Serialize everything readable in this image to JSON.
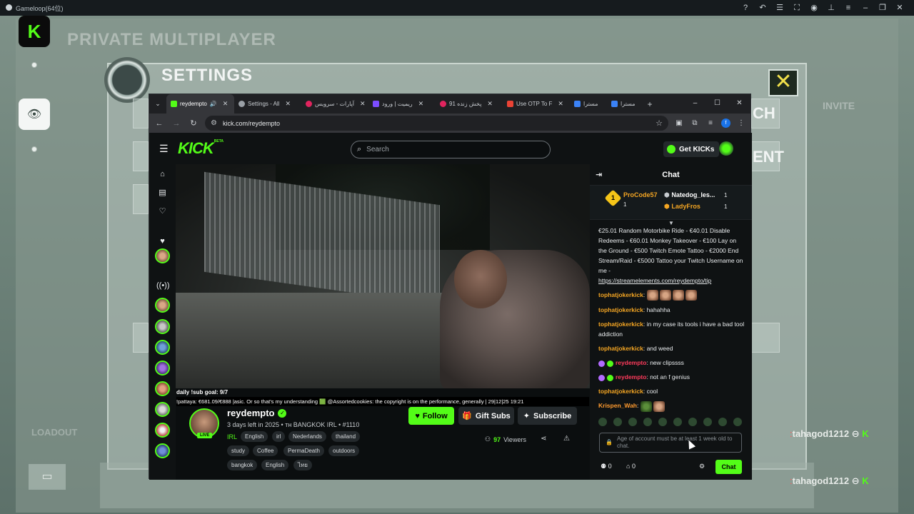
{
  "emulator": {
    "title": "Gameloop(64位)"
  },
  "game": {
    "title_private": "PRIVATE MULTIPLAYER",
    "settings_title": "SETTINGS",
    "right_label_1": "CH",
    "right_label_2": "ENT",
    "invite_label": "INVITE",
    "loadout_label": "LOADOUT",
    "chat_user_1": "tahagod1212",
    "chat_user_2": "tahagod1212",
    "close_glyph": "✕"
  },
  "browser": {
    "tabs": [
      {
        "label": "reydempto",
        "color": "#53fc18",
        "active": true
      },
      {
        "label": "Settings - All",
        "color": "#9aa0a6",
        "active": false
      },
      {
        "label": "آپارات - سرویس",
        "color": "#e0245e",
        "active": false
      },
      {
        "label": "ریمیت | ورود",
        "color": "#7c4dff",
        "active": false
      },
      {
        "label": "پخش زنده 91",
        "color": "#e0245e",
        "active": false
      },
      {
        "label": "Use OTP To F",
        "color": "#ea4335",
        "active": false
      },
      {
        "label": "مسترا",
        "color": "#3b82f6",
        "active": false
      },
      {
        "label": "مسترا",
        "color": "#3b82f6",
        "active": false
      }
    ],
    "url": "kick.com/reydempto",
    "profile_letter": "f"
  },
  "kick": {
    "logo": "KICK",
    "logo_beta": "BETA",
    "search_placeholder": "Search",
    "get_kicks": "Get KICKs",
    "sub_goal": "daily !sub goal: 9/7",
    "ticker": "!pattaya: €681.09/€888  |asic. Or so that's my understanding   🟩 @Assortedcookies:   the copyright is on the performance, generally | 29|12|25 19:21",
    "channel": {
      "name": "reydempto",
      "live": "LIVE",
      "title": "3 days left in 2025 • тн BANGKOK IRL • #1110",
      "category": "IRL",
      "tags": [
        "English",
        "irl",
        "Nederlands",
        "thailand",
        "study",
        "Coffee",
        "PermaDeath",
        "outdoors",
        "bangkok",
        "English",
        "ไทย"
      ],
      "viewers_count": "97",
      "viewers_label": "Viewers"
    },
    "buttons": {
      "follow": "Follow",
      "gift_subs": "Gift Subs",
      "subscribe": "Subscribe"
    },
    "chat": {
      "title": "Chat",
      "pinned": [
        {
          "user": "ProCode57",
          "count": "1"
        },
        {
          "user": "Natedog_les...",
          "count": "1"
        },
        {
          "user": "LadyFros",
          "count": "1"
        }
      ],
      "pinned_rank": "1",
      "pinned_count_first": "1",
      "messages": [
        {
          "user": "",
          "text": "€25.01 Random Motorbike Ride - €40.01 Disable Redeems - €60.01 Monkey Takeover - €100 Lay on the Ground - €500 Twitch Emote Tattoo - €2000 End Stream/Raid - €5000 Tattoo your Twitch Username on me -"
        },
        {
          "user": "",
          "text": "https://streamelements.com/reydempto/tip"
        },
        {
          "user": "tophatjokerkick",
          "text": ""
        },
        {
          "user": "tophatjokerkick",
          "text": "hahahha"
        },
        {
          "user": "tophatjokerkick",
          "text": "in my case its tools i have a bad tool addiction"
        },
        {
          "user": "tophatjokerkick",
          "text": "and weed"
        },
        {
          "user": "reydempto",
          "text": "new clipssss"
        },
        {
          "user": "reydempto",
          "text": "not an f genius"
        },
        {
          "user": "tophatjokerkick",
          "text": "cool"
        },
        {
          "user": "Krispen_Wah",
          "text": ""
        }
      ],
      "input_placeholder": "Age of account must be at least 1 week old to chat.",
      "points_1": "0",
      "points_2": "0",
      "send": "Chat"
    }
  },
  "colors": {
    "kick_green": "#53fc18",
    "dark_bg": "#0b0e0f"
  }
}
